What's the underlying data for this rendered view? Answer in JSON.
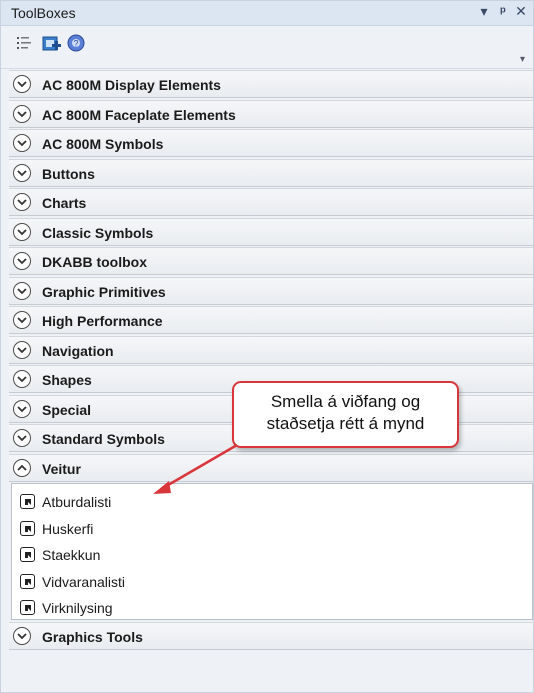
{
  "window": {
    "title": "ToolBoxes",
    "pin_glyph": "▾",
    "dock_glyph": "ᵃ",
    "close_glyph": "✕"
  },
  "toolbar": {
    "icons": [
      "list-view-icon",
      "add-item-icon",
      "help-icon"
    ],
    "overflow_glyph": "▾"
  },
  "groups": [
    {
      "label": "AC 800M Display Elements"
    },
    {
      "label": "AC 800M Faceplate Elements"
    },
    {
      "label": "AC 800M Symbols"
    },
    {
      "label": "Buttons"
    },
    {
      "label": "Charts"
    },
    {
      "label": "Classic Symbols"
    },
    {
      "label": "DKABB toolbox"
    },
    {
      "label": "Graphic Primitives"
    },
    {
      "label": "High Performance"
    },
    {
      "label": "Navigation"
    },
    {
      "label": "Shapes"
    },
    {
      "label": "Special"
    },
    {
      "label": "Standard Symbols"
    }
  ],
  "expanded_group": {
    "label": "Veitur",
    "items": [
      {
        "label": "Atburdalisti"
      },
      {
        "label": "Huskerfi"
      },
      {
        "label": "Staekkun"
      },
      {
        "label": "Vidvaranalisti"
      },
      {
        "label": "Virknilysing"
      }
    ]
  },
  "last_group": {
    "label": "Graphics Tools"
  },
  "callout": {
    "line1": "Smella á viðfang og",
    "line2": "staðsetja rétt á mynd"
  },
  "colors": {
    "accent": "#d9363b",
    "titlebar": "#dce6f2"
  }
}
